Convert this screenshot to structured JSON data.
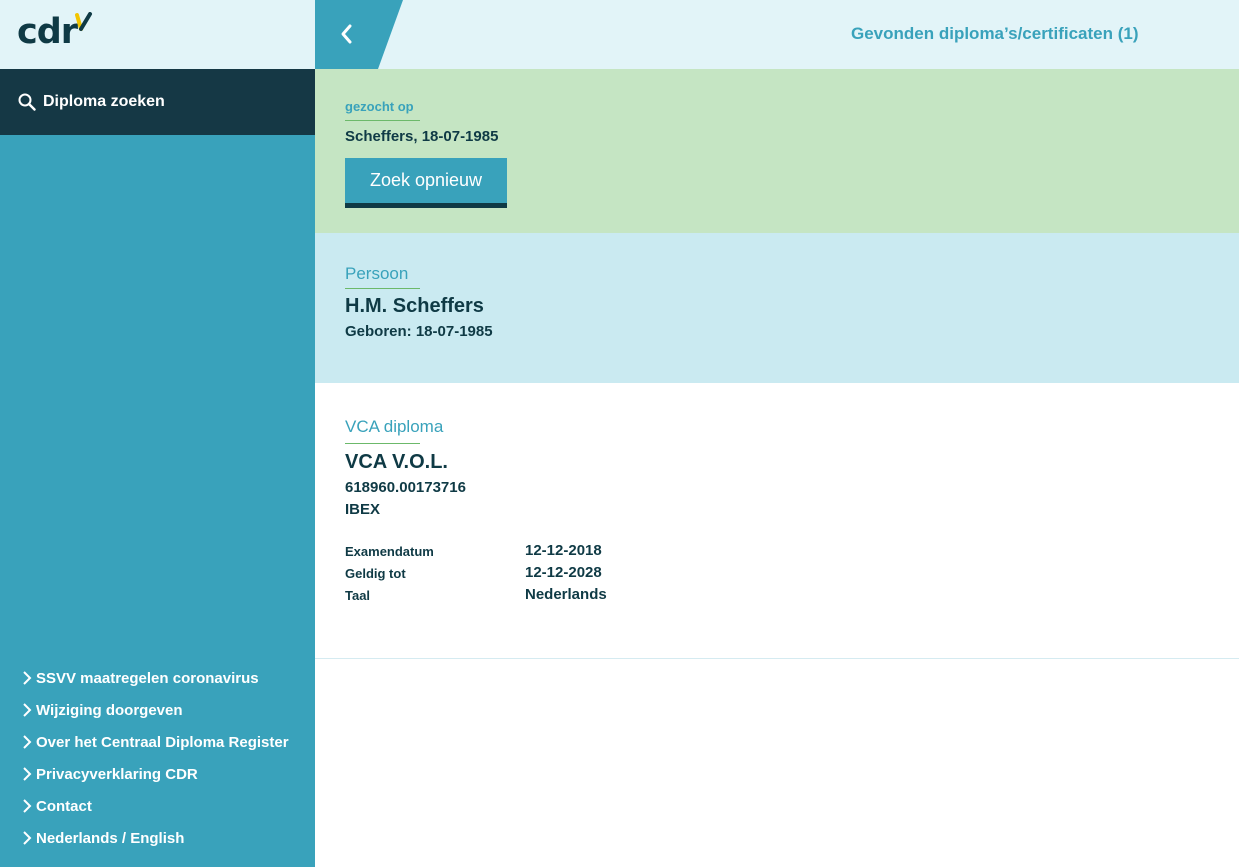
{
  "logo": {
    "text": "cdr",
    "check_color": "#f2c500"
  },
  "sidebar": {
    "search_label": "Diploma zoeken",
    "footer_links": [
      {
        "label": "SSVV maatregelen coronavirus"
      },
      {
        "label": "Wijziging doorgeven"
      },
      {
        "label": "Over het Centraal Diploma Register"
      },
      {
        "label": "Privacyverklaring CDR"
      },
      {
        "label": "Contact"
      },
      {
        "label": "Nederlands / English"
      }
    ]
  },
  "header": {
    "title": "Gevonden diploma’s/certificaten (1)"
  },
  "search_info": {
    "label": "gezocht op",
    "query": "Scheffers, 18-07-1985",
    "retry_label": "Zoek opnieuw"
  },
  "person": {
    "label": "Persoon",
    "name": "H.M. Scheffers",
    "born": "Geboren: 18-07-1985"
  },
  "diploma": {
    "label": "VCA diploma",
    "title": "VCA V.O.L.",
    "number": "618960.00173716",
    "issuer": "IBEX",
    "details": [
      {
        "key": "Examendatum",
        "value": "12-12-2018"
      },
      {
        "key": "Geldig tot",
        "value": "12-12-2028"
      },
      {
        "key": "Taal",
        "value": "Nederlands"
      }
    ]
  },
  "colors": {
    "primary": "#39a2bb",
    "dark": "#0f3a45",
    "search_bg": "#c5e5c3",
    "person_bg": "#caeaf1",
    "header_bg": "#e2f4f8"
  }
}
